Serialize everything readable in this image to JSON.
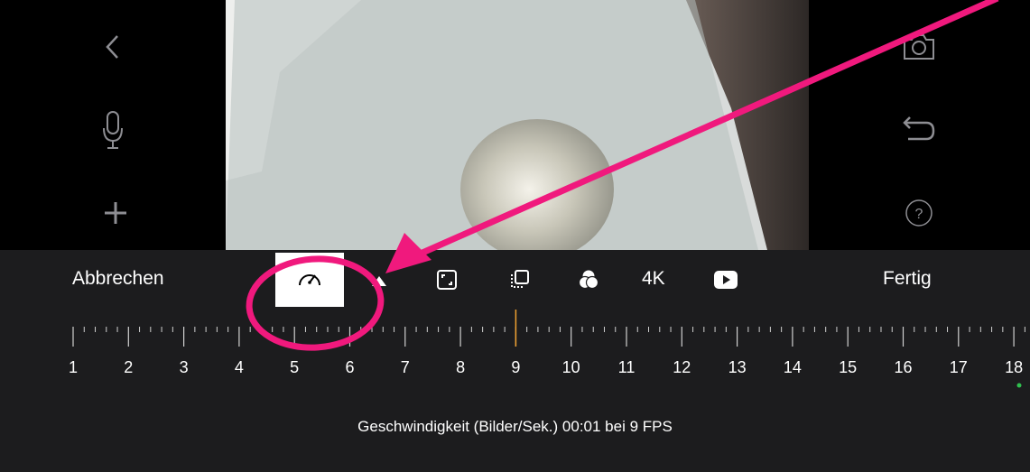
{
  "toolbar": {
    "cancel_label": "Abbrechen",
    "done_label": "Fertig",
    "resolution_label": "4K"
  },
  "ruler": {
    "labels": [
      "1",
      "2",
      "3",
      "4",
      "5",
      "6",
      "7",
      "8",
      "9",
      "10",
      "11",
      "12",
      "13",
      "14",
      "15",
      "16",
      "17",
      "18"
    ],
    "selected_value": 9
  },
  "status": {
    "text": "Geschwindigkeit (Bilder/Sek.) 00:01 bei 9 FPS"
  },
  "colors": {
    "accent_marker": "#f0a030",
    "annotation": "#f0197d",
    "toolbar_bg": "#1c1c1e",
    "end_dot": "#30c04f"
  },
  "icons": {
    "left_rail": [
      "back-chevron-icon",
      "microphone-icon",
      "plus-icon"
    ],
    "right_rail": [
      "camera-icon",
      "undo-icon",
      "help-icon"
    ],
    "toolbar": [
      "speedometer-icon",
      "triangle-icon",
      "crop-frame-icon",
      "overlay-layers-icon",
      "color-filter-icon",
      "play-icon"
    ]
  }
}
